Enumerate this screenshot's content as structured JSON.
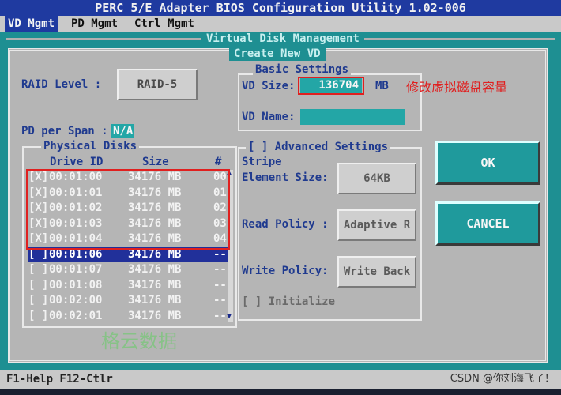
{
  "title_bar": "PERC 5/E Adapter BIOS Configuration Utility 1.02-006",
  "menu": {
    "items": [
      "VD Mgmt",
      "PD Mgmt",
      "Ctrl Mgmt"
    ],
    "active": "VD Mgmt"
  },
  "panel_title": "Virtual Disk Management",
  "dialog_title": "Create New VD",
  "raid_level": {
    "label": "RAID Level :",
    "value": "RAID-5"
  },
  "pd_per_span": {
    "label": "PD per Span :",
    "value": "N/A"
  },
  "physical_disks": {
    "title": "Physical Disks",
    "headers": [
      "Drive ID",
      "Size",
      "#"
    ],
    "rows": [
      {
        "check": "[X]",
        "drive": "00:01:00",
        "size": "34176 MB",
        "num": "00"
      },
      {
        "check": "[X]",
        "drive": "00:01:01",
        "size": "34176 MB",
        "num": "01"
      },
      {
        "check": "[X]",
        "drive": "00:01:02",
        "size": "34176 MB",
        "num": "02"
      },
      {
        "check": "[X]",
        "drive": "00:01:03",
        "size": "34176 MB",
        "num": "03"
      },
      {
        "check": "[X]",
        "drive": "00:01:04",
        "size": "34176 MB",
        "num": "04"
      },
      {
        "check": "[ ]",
        "drive": "00:01:06",
        "size": "34176 MB",
        "num": "--"
      },
      {
        "check": "[ ]",
        "drive": "00:01:07",
        "size": "34176 MB",
        "num": "--"
      },
      {
        "check": "[ ]",
        "drive": "00:01:08",
        "size": "34176 MB",
        "num": "--"
      },
      {
        "check": "[ ]",
        "drive": "00:02:00",
        "size": "34176 MB",
        "num": "--"
      },
      {
        "check": "[ ]",
        "drive": "00:02:01",
        "size": "34176 MB",
        "num": "--"
      }
    ],
    "selected_index": 5
  },
  "basic_settings": {
    "title": "Basic Settings",
    "vd_size_label": "VD Size:",
    "vd_size_value": "136704",
    "vd_size_unit": "MB",
    "vd_name_label": "VD Name:",
    "vd_name_value": ""
  },
  "advanced_settings": {
    "title": "[ ] Advanced Settings",
    "stripe_label_1": "Stripe",
    "stripe_label_2": "Element Size:",
    "stripe_value": "64KB",
    "read_policy_label": "Read Policy :",
    "read_policy_value": "Adaptive R",
    "write_policy_label": "Write Policy:",
    "write_policy_value": "Write Back",
    "initialize_label": "[ ] Initialize"
  },
  "buttons": {
    "ok": "OK",
    "cancel": "CANCEL"
  },
  "help_bar": "F1-Help F12-Ctlr",
  "annotation": "修改虚拟磁盘容量",
  "watermarks": {
    "center": "格云数据",
    "credit": "CSDN @你刘海飞了！"
  },
  "colors": {
    "title_blue": "#1f3aa0",
    "teal": "#1e8f92",
    "dialog_grey": "#b5b5b5",
    "annotation_red": "#e02020"
  }
}
